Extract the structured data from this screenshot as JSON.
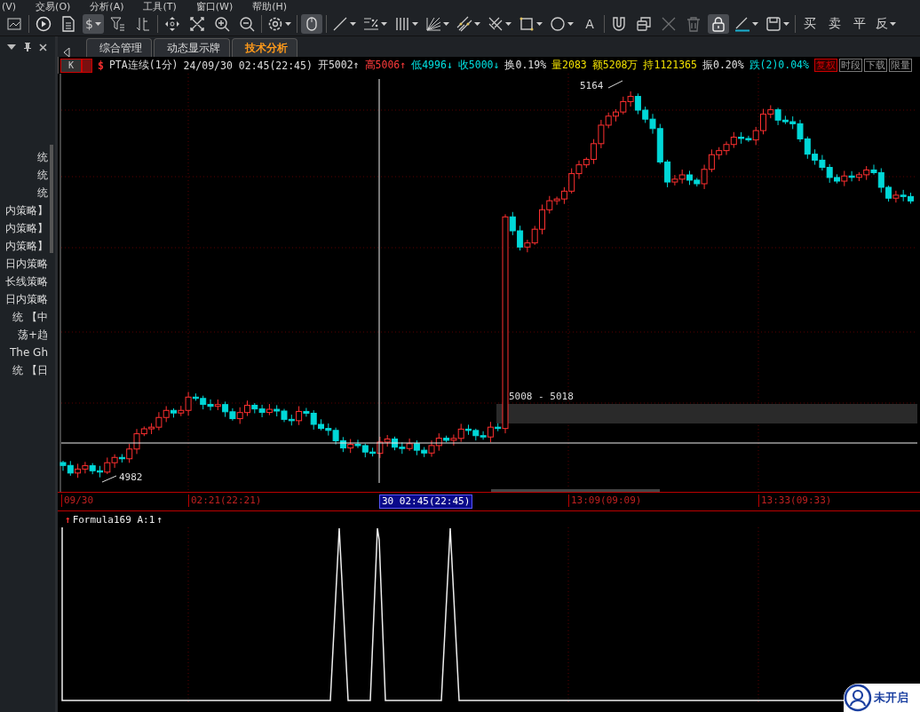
{
  "menu_bar": [
    "(V)",
    "交易(O)",
    "分析(A)",
    "工具(T)",
    "窗口(W)",
    "帮助(H)"
  ],
  "toolbar": [
    {
      "kind": "chart",
      "selected": false,
      "disabled": false,
      "dropdown": false
    },
    {
      "kind": "play",
      "selected": false,
      "disabled": false,
      "dropdown": false
    },
    {
      "kind": "doc",
      "selected": false,
      "disabled": false,
      "dropdown": false
    },
    {
      "kind": "label",
      "label": "$",
      "selected": true,
      "disabled": false,
      "dropdown": true
    },
    {
      "kind": "filter",
      "selected": false,
      "disabled": false,
      "dropdown": false
    },
    {
      "kind": "sort",
      "selected": false,
      "disabled": false,
      "dropdown": false
    },
    {
      "kind": "move",
      "selected": false,
      "disabled": false,
      "dropdown": false
    },
    {
      "kind": "fit",
      "selected": false,
      "disabled": false,
      "dropdown": false
    },
    {
      "kind": "zoomin",
      "selected": false,
      "disabled": false,
      "dropdown": false
    },
    {
      "kind": "zoomout",
      "selected": false,
      "disabled": false,
      "dropdown": false
    },
    {
      "kind": "gear",
      "selected": false,
      "disabled": false,
      "dropdown": true
    },
    {
      "kind": "mouse",
      "selected": true,
      "disabled": false,
      "dropdown": false
    },
    {
      "kind": "line",
      "selected": false,
      "disabled": false,
      "dropdown": true
    },
    {
      "kind": "percent",
      "selected": false,
      "disabled": false,
      "dropdown": true
    },
    {
      "kind": "bars",
      "selected": false,
      "disabled": false,
      "dropdown": true
    },
    {
      "kind": "fan",
      "selected": false,
      "disabled": false,
      "dropdown": true
    },
    {
      "kind": "channel",
      "selected": false,
      "disabled": false,
      "dropdown": true
    },
    {
      "kind": "fork",
      "selected": false,
      "disabled": false,
      "dropdown": true
    },
    {
      "kind": "rect",
      "selected": false,
      "disabled": false,
      "dropdown": true
    },
    {
      "kind": "circle",
      "selected": false,
      "disabled": false,
      "dropdown": true
    },
    {
      "kind": "label",
      "label": "A",
      "selected": false,
      "disabled": false,
      "dropdown": false
    },
    {
      "kind": "magnet",
      "selected": false,
      "disabled": false,
      "dropdown": false
    },
    {
      "kind": "copy",
      "selected": false,
      "disabled": false,
      "dropdown": false
    },
    {
      "kind": "cross",
      "selected": false,
      "disabled": true,
      "dropdown": false
    },
    {
      "kind": "trash",
      "selected": false,
      "disabled": true,
      "dropdown": false
    },
    {
      "kind": "lock",
      "selected": true,
      "disabled": false,
      "dropdown": false
    },
    {
      "kind": "pen",
      "selected": false,
      "disabled": false,
      "dropdown": true
    },
    {
      "kind": "save",
      "selected": false,
      "disabled": false,
      "dropdown": true
    },
    {
      "kind": "label",
      "label": "买",
      "selected": false,
      "disabled": false,
      "dropdown": false
    },
    {
      "kind": "label",
      "label": "卖",
      "selected": false,
      "disabled": false,
      "dropdown": false
    },
    {
      "kind": "label",
      "label": "平",
      "selected": false,
      "disabled": false,
      "dropdown": false
    },
    {
      "kind": "label",
      "label": "反",
      "selected": false,
      "disabled": false,
      "dropdown": true
    }
  ],
  "sidebar": {
    "items": [
      "统",
      "统",
      "统",
      "内策略】",
      "内策略】",
      "内策略】",
      "日内策略",
      "长线策略",
      "日内策略",
      "统 【中",
      "荡+趋",
      "The Gh",
      "统 【日"
    ]
  },
  "tabs": [
    {
      "label": "综合管理",
      "selected": false
    },
    {
      "label": "动态显示牌",
      "selected": false
    },
    {
      "label": "技术分析",
      "selected": true
    }
  ],
  "info_bar": {
    "period_button": "K",
    "symbol_icon": "$",
    "symbol": "PTA连续(1分)",
    "time": "24/09/30 02:45(22:45)",
    "fields": [
      {
        "text": "开5002",
        "arrow": "↑",
        "color": "#e0e0e0"
      },
      {
        "text": "高5006",
        "arrow": "↑",
        "color": "#ff3b3b"
      },
      {
        "text": "低4996",
        "arrow": "↓",
        "color": "#00e0e0"
      },
      {
        "text": "收5000",
        "arrow": "↓",
        "color": "#00e0e0"
      },
      {
        "text": "换0.19%",
        "color": "#e0e0e0"
      },
      {
        "text": "量2083",
        "color": "#f0e000"
      },
      {
        "text": "额5208万",
        "color": "#f0e000"
      },
      {
        "text": "持1121365",
        "color": "#f0e000"
      },
      {
        "text": "振0.20%",
        "color": "#e0e0e0"
      },
      {
        "text": "跌(2)0.04%",
        "color": "#00e0e0"
      }
    ],
    "buttons": [
      {
        "label": "复权",
        "selected": true
      },
      {
        "label": "时段",
        "selected": false
      },
      {
        "label": "下载",
        "selected": false
      },
      {
        "label": "限量",
        "selected": false
      }
    ]
  },
  "chart": {
    "high_label": "5164",
    "low_label": "4982",
    "range_label": "5008 - 5018"
  },
  "time_axis": [
    {
      "label": "09/30",
      "selected": false
    },
    {
      "label": "02:21(22:21)",
      "selected": false
    },
    {
      "label": "30 02:45(22:45)",
      "selected": true
    },
    {
      "label": "13:09(09:09)",
      "selected": false
    },
    {
      "label": "13:33(09:33)",
      "selected": false
    }
  ],
  "indicator": {
    "up_arrow": "↑",
    "title": "Formula169 A:1",
    "value_arrow": "↑"
  },
  "assistant_widget": {
    "label": "未开启"
  }
}
